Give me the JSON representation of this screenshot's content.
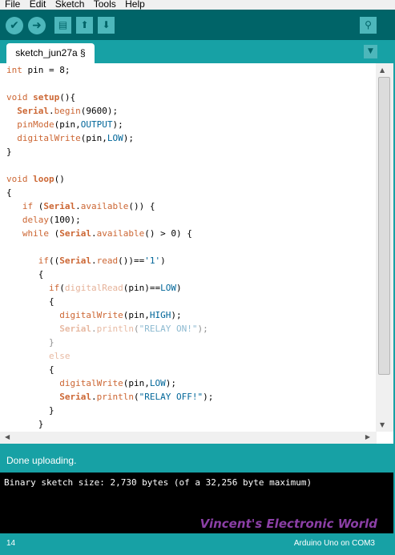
{
  "menu": [
    "File",
    "Edit",
    "Sketch",
    "Tools",
    "Help"
  ],
  "toolbar": {
    "verify_icon": "checkmark-icon",
    "upload_icon": "right-arrow-icon",
    "new_icon": "document-icon",
    "open_icon": "up-arrow-icon",
    "save_icon": "down-arrow-icon",
    "serial_monitor_icon": "magnifier-icon"
  },
  "tab": {
    "label": "sketch_jun27a §"
  },
  "colors": {
    "toolbar": "#006468",
    "accent": "#17a1a5",
    "button": "#4db7bb",
    "keyword": "#cc6633",
    "constant": "#006699",
    "watermark": "#8b3fa6"
  },
  "code_lines": [
    "int pin = 8;",
    "",
    "void setup(){",
    "  Serial.begin(9600);",
    "  pinMode(pin,OUTPUT);",
    "  digitalWrite(pin,LOW);",
    "}",
    "",
    "void loop()",
    "{",
    "   if (Serial.available()) {",
    "   delay(100);",
    "   while (Serial.available() > 0) {",
    "",
    "      if((Serial.read())=='1')",
    "      {",
    "        if(digitalRead(pin)==LOW)",
    "        {",
    "          digitalWrite(pin,HIGH);",
    "          Serial.println(\"RELAY ON!\");",
    "        }",
    "        else",
    "        {",
    "          digitalWrite(pin,LOW);",
    "          Serial.println(\"RELAY OFF!\");",
    "        }",
    "      }"
  ],
  "status": {
    "message": "Done uploading."
  },
  "console": {
    "output": "Binary sketch size: 2,730 bytes (of a 32,256 byte maximum)"
  },
  "watermark": "Vincent's Electronic World",
  "footer": {
    "line_number": "14",
    "board": "Arduino Uno on COM3"
  }
}
